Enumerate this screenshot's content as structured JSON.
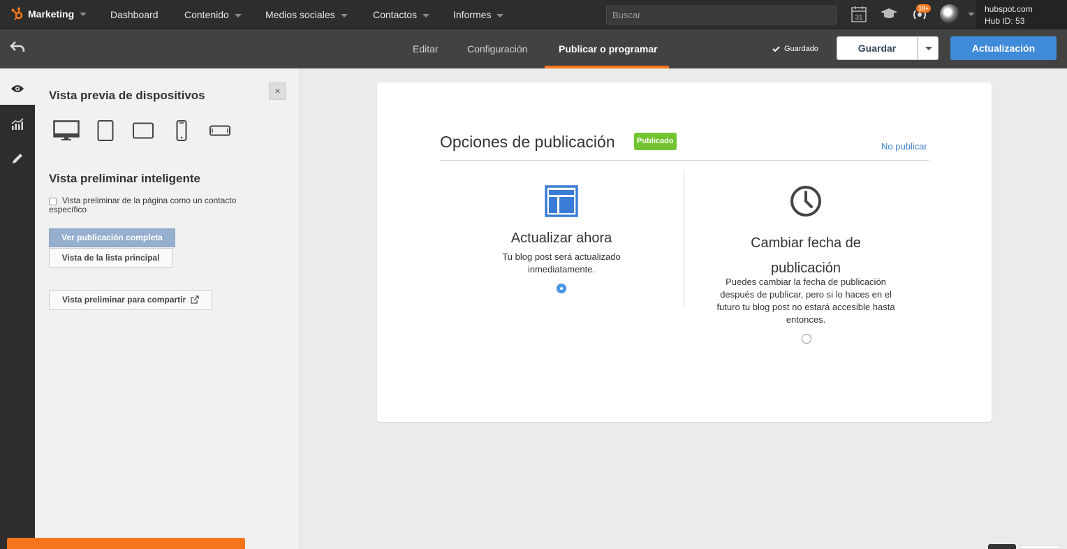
{
  "topnav": {
    "brand": "Marketing",
    "items": [
      "Dashboard",
      "Contenido",
      "Medios sociales",
      "Contactos",
      "Informes"
    ],
    "search_placeholder": "Buscar",
    "calendar_day": "31",
    "notifications_badge": "10+",
    "account_domain": "hubspot.com",
    "hub_id": "Hub ID: 53"
  },
  "subnav": {
    "tabs": [
      "Editar",
      "Configuración",
      "Publicar o programar"
    ],
    "active_tab": "Publicar o programar",
    "saved_label": "Guardado",
    "save_button": "Guardar",
    "update_button": "Actualización"
  },
  "panel": {
    "device_preview_title": "Vista previa de dispositivos",
    "close_label": "×",
    "devices": [
      "desktop",
      "tablet",
      "tablet-landscape",
      "mobile",
      "mobile-landscape"
    ],
    "smart_preview_title": "Vista preliminar inteligente",
    "smart_preview_checkbox": "Vista preliminar de la página como un contacto específico",
    "full_post_button": "Ver publicación completa",
    "main_list_button": "Vista de la lista principal",
    "share_preview_button": "Vista preliminar para compartir"
  },
  "publish": {
    "title": "Opciones de publicación",
    "status_badge": "Publicado",
    "unpublish_link": "No publicar",
    "options": [
      {
        "icon": "layout-icon",
        "heading": "Actualizar ahora",
        "description": "Tu blog post será actualizado inmediatamente.",
        "selected": true
      },
      {
        "icon": "clock-icon",
        "heading": "Cambiar fecha de publicación",
        "description": "Puedes cambiar la fecha de publicación después de publicar, pero si lo haces en el futuro tu blog post no estará accesible hasta entonces.",
        "selected": false
      }
    ]
  },
  "colors": {
    "accent_orange": "#f5761a",
    "primary_blue": "#3f8ad9",
    "published_green": "#71c42f",
    "link_blue": "#3d7fc7"
  }
}
